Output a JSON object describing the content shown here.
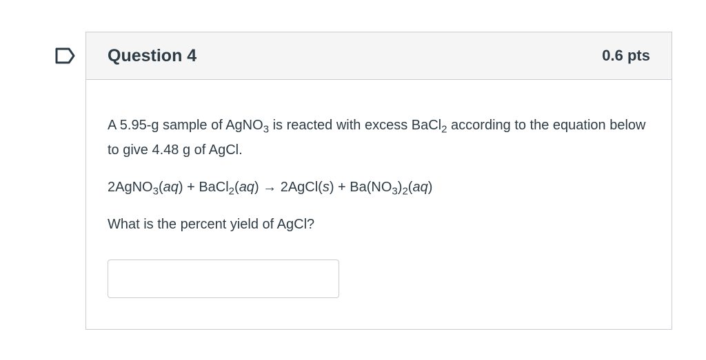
{
  "question": {
    "title": "Question 4",
    "points": "0.6 pts",
    "flag_icon": "bookmark-flag-icon",
    "body": {
      "line1": {
        "t1": "A 5.95-g sample of AgNO",
        "s1": "3",
        "t2": " is reacted with excess BaCl",
        "s2": "2",
        "t3": " according to the equation below to give 4.48 g of AgCl."
      },
      "equation": {
        "t1": "2AgNO",
        "s1": "3",
        "t2": "(",
        "i1": "aq",
        "t3": ") + BaCl",
        "s2": "2",
        "t4": "(",
        "i2": "aq",
        "t5": ") → 2AgCl(",
        "i3": "s",
        "t6": ") + Ba(NO",
        "s3": "3",
        "t7": ")",
        "s4": "2",
        "t8": "(",
        "i4": "aq",
        "t9": ")"
      },
      "prompt": "What is the percent yield of AgCl?"
    },
    "answer_value": ""
  },
  "colors": {
    "border": "#c7cdd1",
    "header_bg": "#f5f5f5",
    "text": "#2d3b45",
    "flag": "#2d3b45"
  }
}
